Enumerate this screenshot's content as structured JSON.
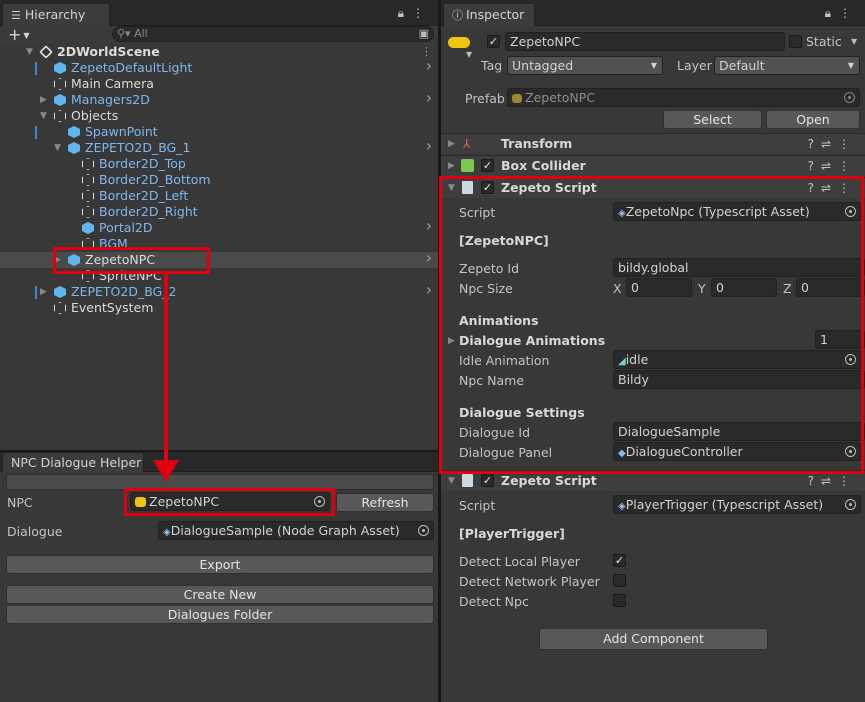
{
  "hierarchy": {
    "tab_label": "Hierarchy",
    "search_placeholder": "All",
    "add_label": "+",
    "items": [
      {
        "label": "2DWorldScene"
      },
      {
        "label": "ZepetoDefaultLight"
      },
      {
        "label": "Main Camera"
      },
      {
        "label": "Managers2D"
      },
      {
        "label": "Objects"
      },
      {
        "label": "SpawnPoint"
      },
      {
        "label": "ZEPETO2D_BG_1"
      },
      {
        "label": "Border2D_Top"
      },
      {
        "label": "Border2D_Bottom"
      },
      {
        "label": "Border2D_Left"
      },
      {
        "label": "Border2D_Right"
      },
      {
        "label": "Portal2D"
      },
      {
        "label": "BGM"
      },
      {
        "label": "ZepetoNPC"
      },
      {
        "label": "SpriteNPC"
      },
      {
        "label": "ZEPETO2D_BG_2"
      },
      {
        "label": "EventSystem"
      }
    ]
  },
  "dialogue_helper": {
    "tab_label": "NPC Dialogue Helper",
    "npc_label": "NPC",
    "npc_value": "ZepetoNPC",
    "refresh_label": "Refresh",
    "dialogue_label": "Dialogue",
    "dialogue_value": "DialogueSample (Node Graph Asset)",
    "export_label": "Export",
    "create_new_label": "Create New",
    "dialogues_folder_label": "Dialogues Folder"
  },
  "inspector": {
    "tab_label": "Inspector",
    "object_name": "ZepetoNPC",
    "static_label": "Static",
    "tag_label": "Tag",
    "tag_value": "Untagged",
    "layer_label": "Layer",
    "layer_value": "Default",
    "prefab_label": "Prefab",
    "prefab_value": "ZepetoNPC",
    "select_label": "Select",
    "open_label": "Open",
    "transform_label": "Transform",
    "box_collider_label": "Box Collider",
    "zepeto_script_label": "Zepeto Script",
    "npc_script": {
      "script_label": "Script",
      "script_value": "ZepetoNpc (Typescript Asset)",
      "section_title": "[ZepetoNPC]",
      "zepeto_id_label": "Zepeto Id",
      "zepeto_id_value": "bildy.global",
      "npc_size_label": "Npc Size",
      "x_label": "X",
      "x_value": "0",
      "y_label": "Y",
      "y_value": "0",
      "z_label": "Z",
      "z_value": "0",
      "animations_title": "Animations",
      "dialogue_animations_label": "Dialogue Animations",
      "dialogue_animations_count": "1",
      "idle_animation_label": "Idle Animation",
      "idle_animation_value": "idle",
      "npc_name_label": "Npc Name",
      "npc_name_value": "Bildy",
      "dialogue_settings_title": "Dialogue Settings",
      "dialogue_id_label": "Dialogue Id",
      "dialogue_id_value": "DialogueSample",
      "dialogue_panel_label": "Dialogue Panel",
      "dialogue_panel_value": "DialogueController"
    },
    "player_script": {
      "script_label": "Script",
      "script_value": "PlayerTrigger (Typescript Asset)",
      "section_title": "[PlayerTrigger]",
      "detect_local_label": "Detect Local Player",
      "detect_network_label": "Detect Network Player",
      "detect_npc_label": "Detect Npc"
    },
    "add_component_label": "Add Component"
  },
  "colors": {
    "accent_red": "#e0000f",
    "link_blue": "#7fb8f0",
    "panel_bg": "#383838"
  }
}
